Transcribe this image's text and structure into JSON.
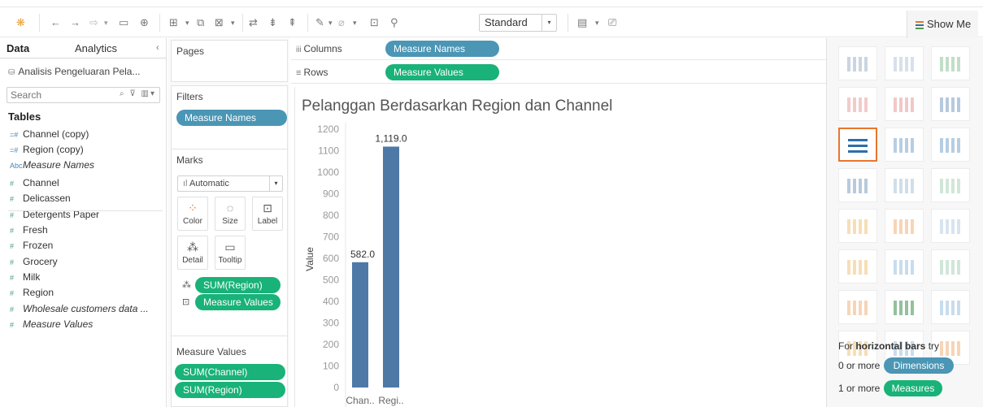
{
  "toolbar": {
    "standard_select": "Standard",
    "show_me_label": "Show Me"
  },
  "data_pane": {
    "tabs": [
      "Data",
      "Analytics"
    ],
    "datasource": "Analisis Pengeluaran Pela...",
    "search_placeholder": "Search",
    "tables_heading": "Tables",
    "fields": [
      {
        "label": "Channel (copy)",
        "icon": "=#",
        "kind": "dim",
        "italic": false
      },
      {
        "label": "Region (copy)",
        "icon": "=#",
        "kind": "dim",
        "italic": false
      },
      {
        "label": "Measure Names",
        "icon": "Abc",
        "kind": "dim",
        "italic": true
      },
      {
        "label": "Channel",
        "icon": "#",
        "kind": "mea",
        "italic": false
      },
      {
        "label": "Delicassen",
        "icon": "#",
        "kind": "mea",
        "italic": false
      },
      {
        "label": "Detergents Paper",
        "icon": "#",
        "kind": "mea",
        "italic": false
      },
      {
        "label": "Fresh",
        "icon": "#",
        "kind": "mea",
        "italic": false
      },
      {
        "label": "Frozen",
        "icon": "#",
        "kind": "mea",
        "italic": false
      },
      {
        "label": "Grocery",
        "icon": "#",
        "kind": "mea",
        "italic": false
      },
      {
        "label": "Milk",
        "icon": "#",
        "kind": "mea",
        "italic": false
      },
      {
        "label": "Region",
        "icon": "#",
        "kind": "mea",
        "italic": false
      },
      {
        "label": "Wholesale customers data ...",
        "icon": "#",
        "kind": "mea",
        "italic": true
      },
      {
        "label": "Measure Values",
        "icon": "#",
        "kind": "mea",
        "italic": true
      }
    ]
  },
  "cards": {
    "pages_title": "Pages",
    "filters_title": "Filters",
    "filters_pill": "Measure Names",
    "marks_title": "Marks",
    "marks_type": "Automatic",
    "mark_buttons": [
      "Color",
      "Size",
      "Label",
      "Detail",
      "Tooltip"
    ],
    "marks_pills": [
      "SUM(Region)",
      "Measure Values"
    ],
    "measure_values_title": "Measure Values",
    "measure_values_pills": [
      "SUM(Channel)",
      "SUM(Region)"
    ]
  },
  "shelves": {
    "columns_label": "Columns",
    "columns_pill": "Measure Names",
    "rows_label": "Rows",
    "rows_pill": "Measure Values"
  },
  "viz": {
    "title": "Pelanggan Berdasarkan Region dan Channel"
  },
  "chart_data": {
    "type": "bar",
    "title": "Pelanggan Berdasarkan Region dan Channel",
    "categories": [
      "Chan..",
      "Regi.."
    ],
    "values": [
      582.0,
      1119.0
    ],
    "data_labels": [
      "582.0",
      "1,119.0"
    ],
    "ylabel": "Value",
    "xlabel": "",
    "ylim": [
      0,
      1200
    ],
    "yticks": [
      0,
      100,
      200,
      300,
      400,
      500,
      600,
      700,
      800,
      900,
      1000,
      1100,
      1200
    ],
    "bar_color": "#4e79a7",
    "grid": false
  },
  "show_me": {
    "hint_prefix": "For ",
    "hint_bold": "horizontal bars",
    "hint_suffix": " try",
    "dims_prefix": "0 or more",
    "dims_pill": "Dimensions",
    "meas_prefix": "1 or more",
    "meas_pill": "Measures"
  },
  "colors": {
    "dimension_pill": "#4b96b5",
    "measure_pill": "#19b278",
    "selected_tile": "#e8762d"
  }
}
